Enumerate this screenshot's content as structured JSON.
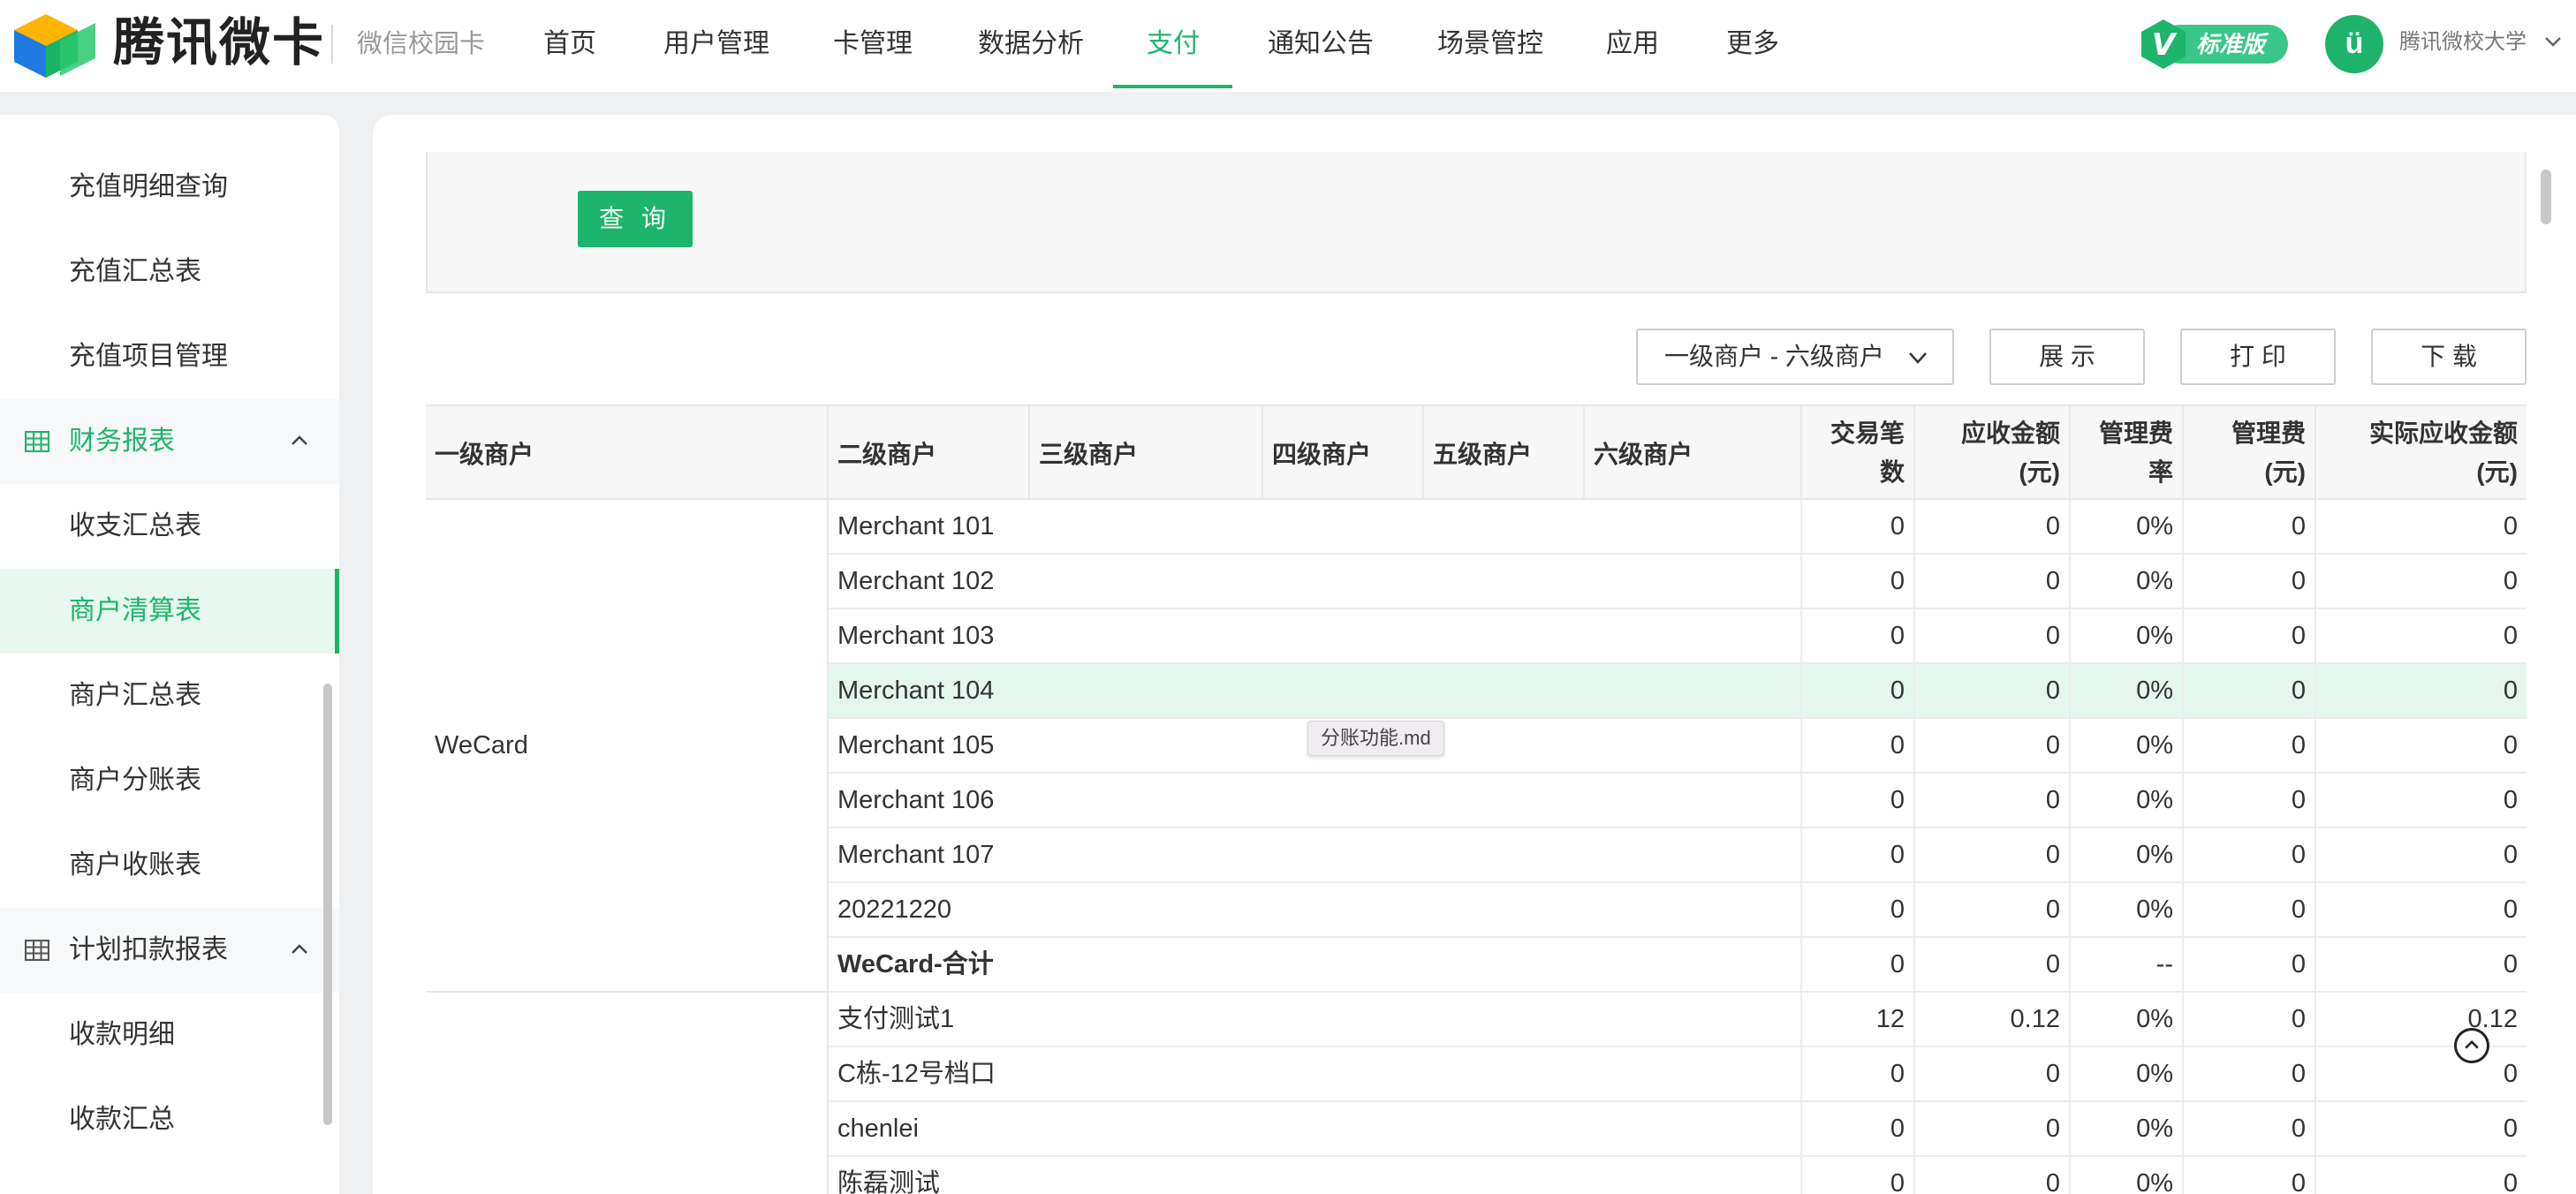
{
  "topbar": {
    "brand": "腾讯微卡",
    "subbrand": "微信校园卡",
    "nav": [
      "首页",
      "用户管理",
      "卡管理",
      "数据分析",
      "支付",
      "通知公告",
      "场景管控",
      "应用",
      "更多"
    ],
    "active_nav": "支付",
    "badge_letter": "V",
    "badge_text": "标准版",
    "avatar_text": "ü",
    "user_name": "腾讯微校大学",
    "accent": "#1db56b"
  },
  "sidebar": {
    "items_top": [
      "充值明细查询",
      "充值汇总表",
      "充值项目管理"
    ],
    "group1": "财务报表",
    "group1_items": [
      "收支汇总表",
      "商户清算表",
      "商户汇总表",
      "商户分账表",
      "商户收账表"
    ],
    "active_item": "商户清算表",
    "group2": "计划扣款报表",
    "group2_items": [
      "收款明细",
      "收款汇总"
    ]
  },
  "filter": {
    "query_label": "查 询"
  },
  "toolbar": {
    "level_select": "一级商户 - 六级商户",
    "show_label": "展 示",
    "print_label": "打 印",
    "download_label": "下 载"
  },
  "table": {
    "headers": {
      "l1": "一级商户",
      "l2": "二级商户",
      "l3": "三级商户",
      "l4": "四级商户",
      "l5": "五级商户",
      "l6": "六级商户",
      "count": [
        "交易笔",
        "数"
      ],
      "receivable": [
        "应收金额",
        "(元)"
      ],
      "fee_rate": [
        "管理费",
        "率"
      ],
      "fee": [
        "管理费",
        "(元)"
      ],
      "actual": [
        "实际应收金额",
        "(元)"
      ]
    },
    "group_wecard": "WeCard",
    "rows": [
      {
        "name": "Merchant 101",
        "count": "0",
        "receivable": "0",
        "rate": "0%",
        "fee": "0",
        "actual": "0"
      },
      {
        "name": "Merchant 102",
        "count": "0",
        "receivable": "0",
        "rate": "0%",
        "fee": "0",
        "actual": "0"
      },
      {
        "name": "Merchant 103",
        "count": "0",
        "receivable": "0",
        "rate": "0%",
        "fee": "0",
        "actual": "0"
      },
      {
        "name": "Merchant 104",
        "count": "0",
        "receivable": "0",
        "rate": "0%",
        "fee": "0",
        "actual": "0"
      },
      {
        "name": "Merchant 105",
        "count": "0",
        "receivable": "0",
        "rate": "0%",
        "fee": "0",
        "actual": "0"
      },
      {
        "name": "Merchant 106",
        "count": "0",
        "receivable": "0",
        "rate": "0%",
        "fee": "0",
        "actual": "0"
      },
      {
        "name": "Merchant 107",
        "count": "0",
        "receivable": "0",
        "rate": "0%",
        "fee": "0",
        "actual": "0"
      },
      {
        "name": "20221220",
        "count": "0",
        "receivable": "0",
        "rate": "0%",
        "fee": "0",
        "actual": "0"
      },
      {
        "name": "WeCard-合计",
        "count": "0",
        "receivable": "0",
        "rate": "--",
        "fee": "0",
        "actual": "0"
      },
      {
        "name": "支付测试1",
        "count": "12",
        "receivable": "0.12",
        "rate": "0%",
        "fee": "0",
        "actual": "0.12"
      },
      {
        "name": "C栋-12号档口",
        "count": "0",
        "receivable": "0",
        "rate": "0%",
        "fee": "0",
        "actual": "0"
      },
      {
        "name": "chenlei",
        "count": "0",
        "receivable": "0",
        "rate": "0%",
        "fee": "0",
        "actual": "0"
      },
      {
        "name": "陈磊测试",
        "count": "0",
        "receivable": "0",
        "rate": "0%",
        "fee": "0",
        "actual": "0"
      }
    ]
  },
  "tooltip": "分账功能.md"
}
